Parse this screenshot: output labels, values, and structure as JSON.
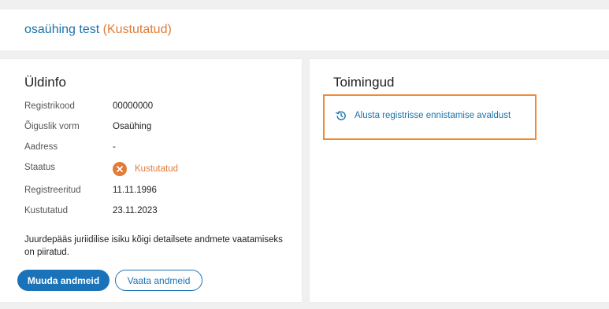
{
  "header": {
    "company_name": "osaühing test",
    "status_label": "(Kustutatud)"
  },
  "general": {
    "title": "Üldinfo",
    "rows": [
      {
        "label": "Registrikood",
        "value": "00000000"
      },
      {
        "label": "Õiguslik vorm",
        "value": "Osaühing"
      },
      {
        "label": "Aadress",
        "value": "-"
      },
      {
        "label": "Staatus",
        "value": "Kustutatud"
      },
      {
        "label": "Registreeritud",
        "value": "11.11.1996"
      },
      {
        "label": "Kustutatud",
        "value": "23.11.2023"
      }
    ],
    "note": "Juurdepääs juriidilise isiku kõigi detailsete andmete vaatamiseks on piiratud.",
    "edit_button": "Muuda andmeid",
    "view_button": "Vaata andmeid"
  },
  "actions": {
    "title": "Toimingud",
    "restore_link": "Alusta registrisse ennistamise avaldust"
  },
  "colors": {
    "accent": "#1a73b8",
    "status_deleted": "#e07b39",
    "highlight_border": "#ef8a36"
  },
  "icons": {
    "status_icon": "x-circle-icon",
    "restore_icon": "restore-history-icon"
  }
}
